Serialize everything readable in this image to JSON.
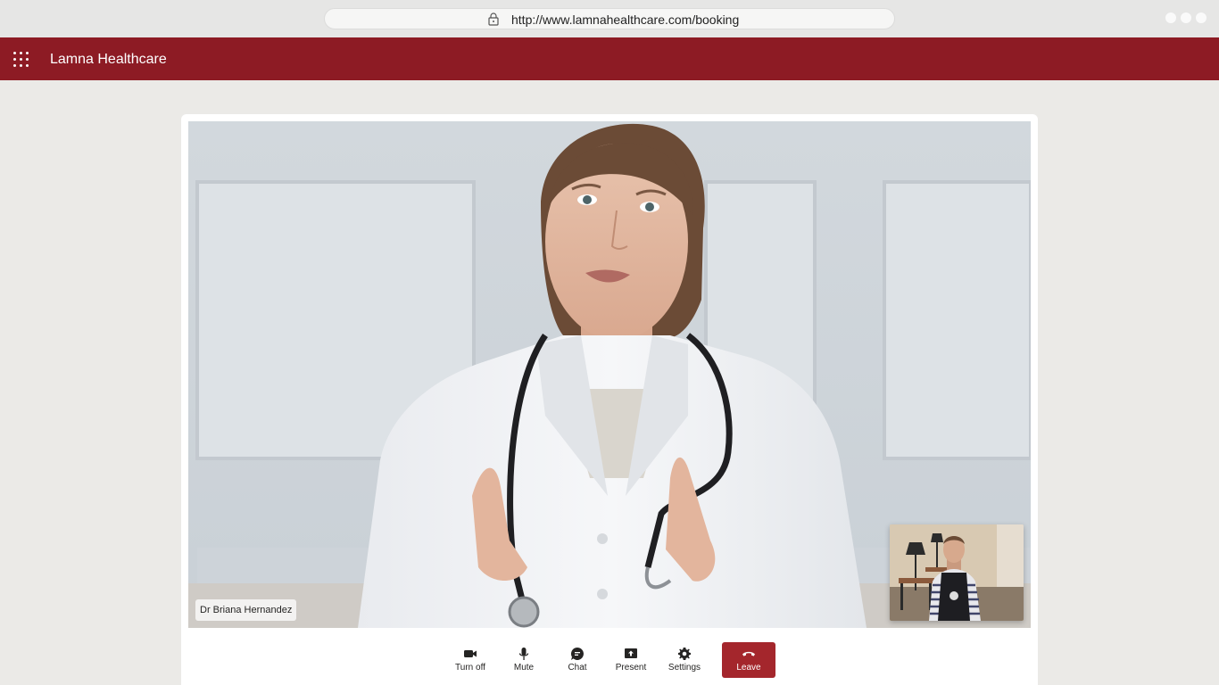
{
  "browser": {
    "url": "http://www.lamnahealthcare.com/booking"
  },
  "app": {
    "title": "Lamna Healthcare",
    "brand_color": "#8d1b24"
  },
  "call": {
    "remote_participant": "Dr Briana Hernandez",
    "controls": [
      {
        "label": "Turn off",
        "icon": "camera-icon"
      },
      {
        "label": "Mute",
        "icon": "microphone-icon"
      },
      {
        "label": "Chat",
        "icon": "chat-icon"
      },
      {
        "label": "Present",
        "icon": "share-screen-icon"
      },
      {
        "label": "Settings",
        "icon": "gear-icon"
      },
      {
        "label": "Leave",
        "icon": "hang-up-icon",
        "color": "#a4262c"
      }
    ]
  }
}
